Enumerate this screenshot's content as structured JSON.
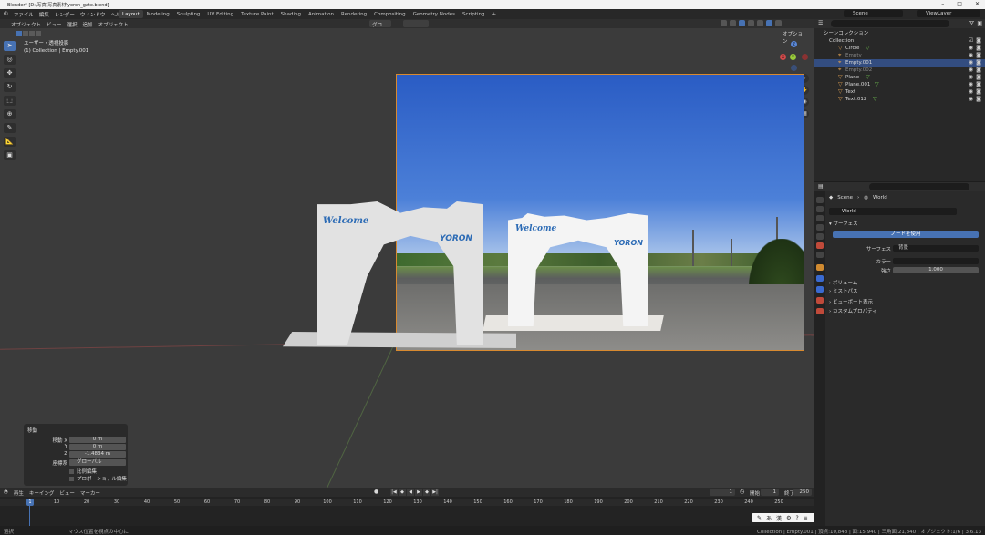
{
  "window": {
    "title": "Blender* [D:\\写真\\写真素材\\yoron_gate.blend]"
  },
  "menu": [
    "ファイル",
    "編集",
    "レンダー",
    "ウィンドウ",
    "ヘルプ"
  ],
  "workspaces": [
    "Layout",
    "Modeling",
    "Sculpting",
    "UV Editing",
    "Texture Paint",
    "Shading",
    "Animation",
    "Rendering",
    "Compositing",
    "Geometry Nodes",
    "Scripting"
  ],
  "active_workspace": "Layout",
  "scene": "Scene",
  "view_layer": "ViewLayer",
  "viewport": {
    "mode": "オブジェクト",
    "menus": [
      "ビュー",
      "選択",
      "追加",
      "オブジェクト"
    ],
    "transform_orientation": "グロ…",
    "options": "オプション",
    "info_line1": "ユーザー・透視投影",
    "info_line2": "(1) Collection | Empty.001",
    "photo_text1": "Welcome",
    "photo_text2": "YORON",
    "model_text1": "Welcome",
    "model_text2": "YORON"
  },
  "gizmo": {
    "x": "X",
    "y": "Y",
    "z": "Z"
  },
  "operator_panel": {
    "title": "移動",
    "move_label": "移動 X",
    "y_label": "Y",
    "z_label": "Z",
    "x": "0 m",
    "y": "0 m",
    "z": "-1.4834 m",
    "orientation_label": "座標系",
    "orientation": "グローバル",
    "proportional_edit": "比例編集",
    "proportional_connected": "プロポーショナル編集"
  },
  "timeline": {
    "menus": [
      "再生",
      "キーイング",
      "ビュー",
      "マーカー"
    ],
    "current_frame": "1",
    "start_label": "開始",
    "start": "1",
    "end_label": "終了",
    "end": "250",
    "ticks": [
      "10",
      "20",
      "30",
      "40",
      "50",
      "60",
      "70",
      "80",
      "90",
      "100",
      "110",
      "120",
      "130",
      "140",
      "150",
      "160",
      "170",
      "180",
      "190",
      "200",
      "210",
      "220",
      "230",
      "240",
      "250"
    ]
  },
  "statusbar": {
    "left1": "選択",
    "left2": "マウス位置を視点の中心に",
    "right": "Collection | Empty.001 | 頂点:10,848 | 面:15,940 | 三角面:21,840 | オブジェクト:1/6 | 3.6.13"
  },
  "outliner": {
    "root": "シーンコレクション",
    "collection": "Collection",
    "items": [
      {
        "name": "Circle",
        "dim": false,
        "selected": false
      },
      {
        "name": "Empty",
        "dim": true,
        "selected": false
      },
      {
        "name": "Empty.001",
        "dim": false,
        "selected": true
      },
      {
        "name": "Empty.002",
        "dim": true,
        "selected": false
      },
      {
        "name": "Plane",
        "dim": false,
        "selected": false
      },
      {
        "name": "Plane.001",
        "dim": false,
        "selected": false
      },
      {
        "name": "Text",
        "dim": false,
        "selected": false
      },
      {
        "name": "Text.012",
        "dim": false,
        "selected": false
      }
    ]
  },
  "properties": {
    "breadcrumb_scene": "Scene",
    "breadcrumb_world": "World",
    "world_name": "World",
    "surface_panel": "サーフェス",
    "use_nodes_button": "ノードを使用",
    "surface_label": "サーフェス",
    "surface_value": "背景",
    "color_label": "カラー",
    "strength_label": "強さ",
    "strength_value": "1.000",
    "volume_panel": "ボリューム",
    "mist_panel": "ミストパス",
    "viewport_display_panel": "ビューポート表示",
    "custom_props_panel": "カスタムプロパティ"
  },
  "colors": {
    "accent": "#4772b3",
    "selection_border": "#d88a30"
  }
}
